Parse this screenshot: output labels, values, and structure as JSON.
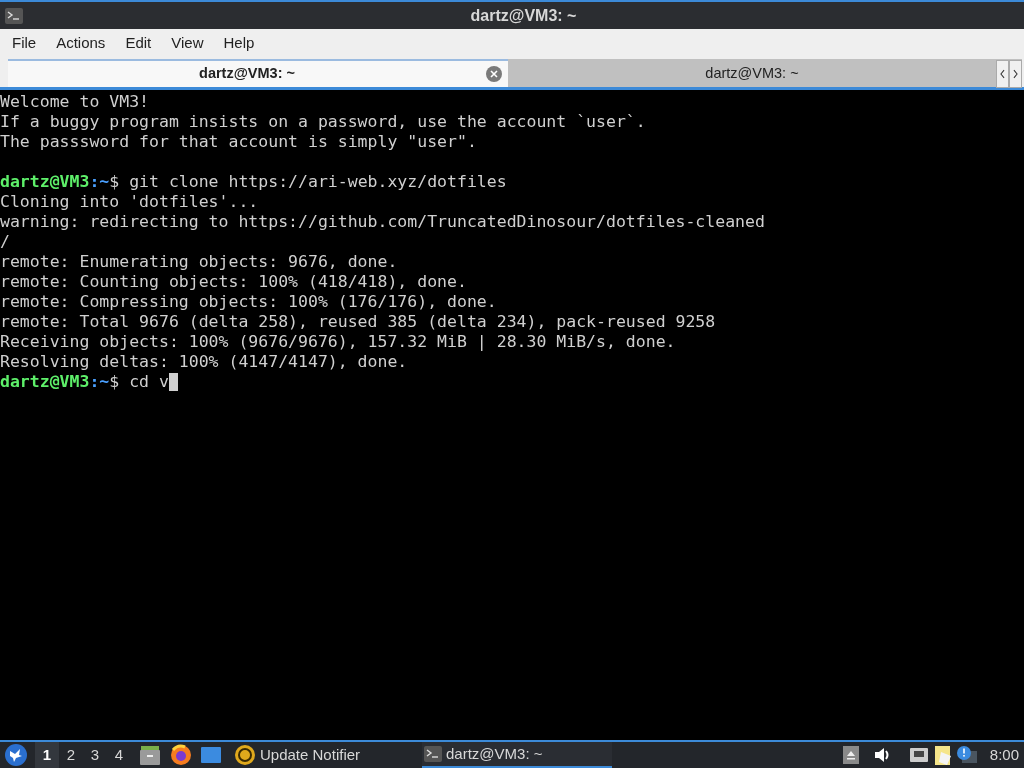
{
  "window": {
    "title": "dartz@VM3: ~"
  },
  "menu": [
    "File",
    "Actions",
    "Edit",
    "View",
    "Help"
  ],
  "tabs": [
    {
      "label": "dartz@VM3: ~",
      "selected": true
    },
    {
      "label": "dartz@VM3: ~",
      "selected": false
    }
  ],
  "terminal": {
    "lines": [
      {
        "kind": "output",
        "text": "Welcome to VM3!"
      },
      {
        "kind": "output",
        "text": "If a buggy program insists on a password, use the account `user`."
      },
      {
        "kind": "output",
        "text": "The passsword for that account is simply \"user\"."
      },
      {
        "kind": "blank"
      },
      {
        "kind": "prompt",
        "user_host": "dartz@VM3",
        "separator": ":",
        "path": "~",
        "symbol": "$",
        "command": "git clone https://ari-web.xyz/dotfiles",
        "cursor": false
      },
      {
        "kind": "output",
        "text": "Cloning into 'dotfiles'..."
      },
      {
        "kind": "output",
        "text": "warning: redirecting to https://github.com/TruncatedDinosour/dotfiles-cleaned"
      },
      {
        "kind": "output",
        "text": "/"
      },
      {
        "kind": "output",
        "text": "remote: Enumerating objects: 9676, done."
      },
      {
        "kind": "output",
        "text": "remote: Counting objects: 100% (418/418), done."
      },
      {
        "kind": "output",
        "text": "remote: Compressing objects: 100% (176/176), done."
      },
      {
        "kind": "output",
        "text": "remote: Total 9676 (delta 258), reused 385 (delta 234), pack-reused 9258"
      },
      {
        "kind": "output",
        "text": "Receiving objects: 100% (9676/9676), 157.32 MiB | 28.30 MiB/s, done."
      },
      {
        "kind": "output",
        "text": "Resolving deltas: 100% (4147/4147), done."
      },
      {
        "kind": "prompt",
        "user_host": "dartz@VM3",
        "separator": ":",
        "path": "~",
        "symbol": "$",
        "command": "cd v",
        "cursor": true
      }
    ]
  },
  "taskbar": {
    "workspaces": [
      {
        "label": "1",
        "selected": true
      },
      {
        "label": "2",
        "selected": false
      },
      {
        "label": "3",
        "selected": false
      },
      {
        "label": "4",
        "selected": false
      }
    ],
    "tasks": [
      {
        "label": "Update Notifier",
        "kind": "update",
        "selected": false
      },
      {
        "label": "dartz@VM3: ~",
        "kind": "terminal",
        "selected": true
      }
    ],
    "clock": "8:00"
  }
}
